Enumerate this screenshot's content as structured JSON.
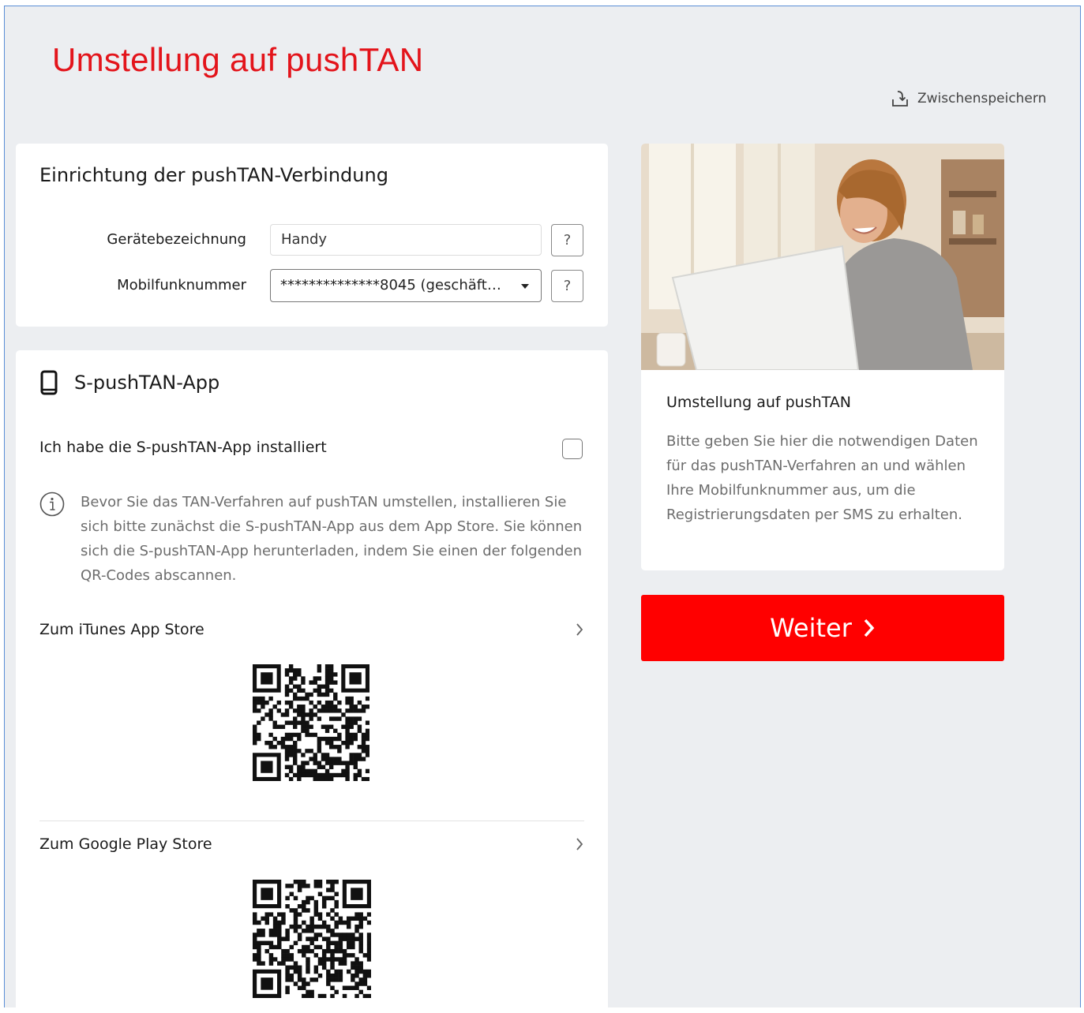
{
  "page": {
    "title": "Umstellung auf pushTAN",
    "save_label": "Zwischenspeichern"
  },
  "setup": {
    "heading": "Einrichtung der pushTAN-Verbindung",
    "device_label": "Gerätebezeichnung",
    "device_value": "Handy",
    "phone_label": "Mobilfunknummer",
    "phone_value": "**************8045 (geschäft…",
    "help_label": "?"
  },
  "app": {
    "heading": "S-pushTAN-App",
    "installed_label": "Ich habe die S-pushTAN-App installiert",
    "info_text": "Bevor Sie das TAN-Verfahren auf pushTAN umstellen, installieren Sie sich bitte zunächst die S-pushTAN-App aus dem App Store. Sie können sich die S-pushTAN-App herunterladen, indem Sie einen der folgenden QR-Codes abscannen.",
    "itunes_label": "Zum iTunes App Store",
    "play_label": "Zum Google Play Store"
  },
  "info_panel": {
    "title": "Umstellung auf pushTAN",
    "body": "Bitte geben Sie hier die notwendigen Daten für das pushTAN-Verfahren an und wählen Ihre Mobilfunknummer aus, um die Registrierungsdaten per SMS zu erhalten."
  },
  "actions": {
    "next_label": "Weiter"
  },
  "colors": {
    "brand_red": "#ff0000",
    "title_red": "#e3141b",
    "background": "#eceef1"
  },
  "icons": [
    "download-tray-icon",
    "smartphone-icon",
    "info-circle-icon",
    "chevron-right-icon",
    "caret-down-icon"
  ]
}
